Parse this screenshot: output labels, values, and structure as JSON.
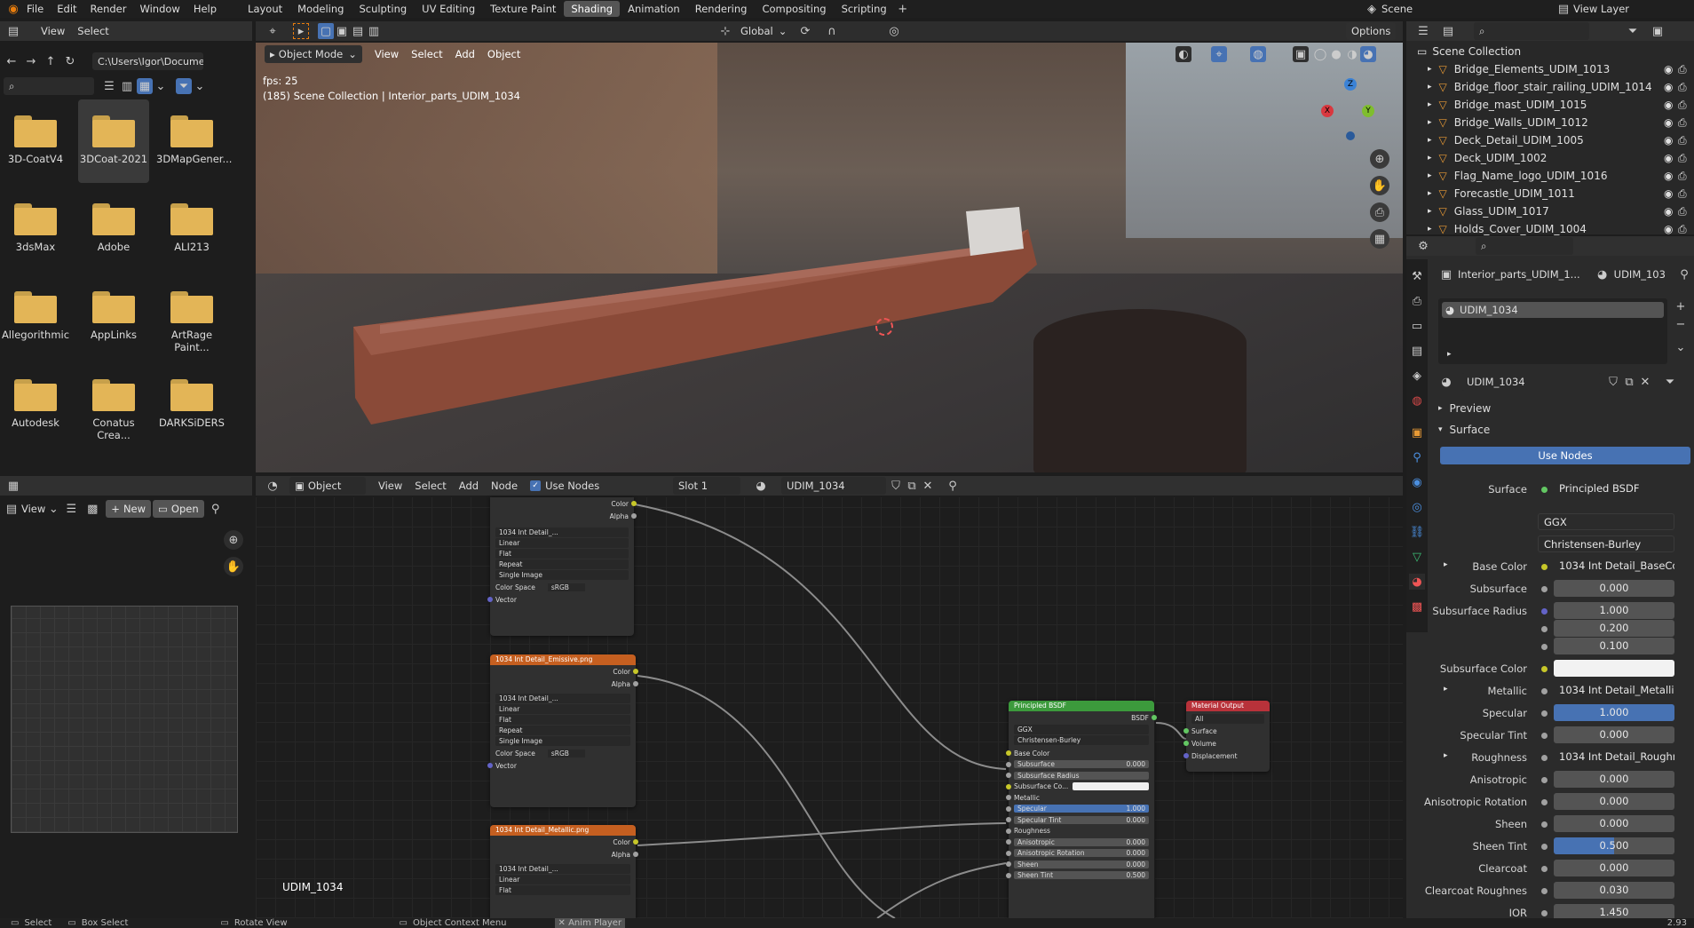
{
  "topbar": {
    "menus": [
      "File",
      "Edit",
      "Render",
      "Window",
      "Help"
    ],
    "workspaces": [
      "Layout",
      "Modeling",
      "Sculpting",
      "UV Editing",
      "Texture Paint",
      "Shading",
      "Animation",
      "Rendering",
      "Compositing",
      "Scripting"
    ],
    "active_workspace": "Shading",
    "scene": "Scene",
    "view_layer": "View Layer"
  },
  "filebrowser": {
    "menus": [
      "View",
      "Select"
    ],
    "path": "C:\\Users\\Igor\\Docume...",
    "search_placeholder": "",
    "folders": [
      "3D-CoatV4",
      "3DCoat-2021",
      "3DMapGener...",
      "3dsMax",
      "Adobe",
      "ALI213",
      "Allegorithmic",
      "AppLinks",
      "ArtRage Paint...",
      "Autodesk",
      "Conatus Crea...",
      "DARKSiDERS"
    ]
  },
  "viewport": {
    "mode": "Object Mode",
    "menus": [
      "View",
      "Select",
      "Add",
      "Object"
    ],
    "orientation": "Global",
    "options": "Options",
    "fps": "fps: 25",
    "info": "(185) Scene Collection | Interior_parts_UDIM_1034",
    "axes": {
      "x": "X",
      "y": "Y",
      "z": "Z"
    }
  },
  "imageeditor": {
    "view": "View",
    "new": "New",
    "open": "Open"
  },
  "nodeeditor": {
    "type": "Object",
    "menus": [
      "View",
      "Select",
      "Add",
      "Node"
    ],
    "use_nodes": "Use Nodes",
    "slot": "Slot 1",
    "material": "UDIM_1034",
    "label": "UDIM_1034",
    "tex1": {
      "image": "1034 Int Detail_...",
      "interp": "Linear",
      "proj": "Flat",
      "ext": "Repeat",
      "src": "Single Image",
      "cs_label": "Color Space",
      "cs": "sRGB",
      "vector": "Vector",
      "color": "Color",
      "alpha": "Alpha"
    },
    "tex2": {
      "title": "1034 Int Detail_Emissive.png",
      "image": "1034 Int Detail_..."
    },
    "tex3": {
      "title": "1034 Int Detail_Metallic.png",
      "image": "1034 Int Detail_..."
    },
    "bsdf": {
      "title": "Principled BSDF",
      "out": "BSDF",
      "dist": "GGX",
      "sss": "Christensen-Burley",
      "rows": [
        [
          "Base Color",
          ""
        ],
        [
          "Subsurface",
          "0.000"
        ],
        [
          "Subsurface Radius",
          ""
        ],
        [
          "Subsurface Co...",
          ""
        ],
        [
          "Metallic",
          ""
        ],
        [
          "Specular",
          "1.000"
        ],
        [
          "Specular Tint",
          "0.000"
        ],
        [
          "Roughness",
          ""
        ],
        [
          "Anisotropic",
          "0.000"
        ],
        [
          "Anisotropic Rotation",
          "0.000"
        ],
        [
          "Sheen",
          "0.000"
        ],
        [
          "Sheen Tint",
          "0.500"
        ]
      ]
    },
    "output": {
      "title": "Material Output",
      "target": "All",
      "rows": [
        "Surface",
        "Volume",
        "Displacement"
      ]
    }
  },
  "outliner": {
    "root": "Scene Collection",
    "items": [
      "Bridge_Elements_UDIM_1013",
      "Bridge_floor_stair_railing_UDIM_1014",
      "Bridge_mast_UDIM_1015",
      "Bridge_Walls_UDIM_1012",
      "Deck_Detail_UDIM_1005",
      "Deck_UDIM_1002",
      "Flag_Name_logo_UDIM_1016",
      "Forecastle_UDIM_1011",
      "Glass_UDIM_1017",
      "Holds_Cover_UDIM_1004"
    ]
  },
  "properties": {
    "object": "Interior_parts_UDIM_1...",
    "material_short": "UDIM_103",
    "slot": "UDIM_1034",
    "material": "UDIM_1034",
    "preview": "Preview",
    "surface_panel": "Surface",
    "use_nodes": "Use Nodes",
    "rows": [
      {
        "label": "Surface",
        "value": "Principled BSDF",
        "kind": "link"
      },
      {
        "label": "",
        "value": "GGX",
        "kind": "dd"
      },
      {
        "label": "",
        "value": "Christensen-Burley",
        "kind": "dd"
      },
      {
        "label": "Base Color",
        "value": "1034 Int Detail_BaseCol...",
        "kind": "link"
      },
      {
        "label": "Subsurface",
        "value": "0.000",
        "kind": "num"
      },
      {
        "label": "Subsurface Radius",
        "value": "1.000",
        "kind": "num"
      },
      {
        "label": "",
        "value": "0.200",
        "kind": "num"
      },
      {
        "label": "",
        "value": "0.100",
        "kind": "num"
      },
      {
        "label": "Subsurface Color",
        "value": "",
        "kind": "color"
      },
      {
        "label": "Metallic",
        "value": "1034 Int Detail_Metallic...",
        "kind": "link"
      },
      {
        "label": "Specular",
        "value": "1.000",
        "kind": "blue"
      },
      {
        "label": "Specular Tint",
        "value": "0.000",
        "kind": "num"
      },
      {
        "label": "Roughness",
        "value": "1034 Int Detail_Roughne...",
        "kind": "link"
      },
      {
        "label": "Anisotropic",
        "value": "0.000",
        "kind": "num"
      },
      {
        "label": "Anisotropic Rotation",
        "value": "0.000",
        "kind": "num"
      },
      {
        "label": "Sheen",
        "value": "0.000",
        "kind": "num"
      },
      {
        "label": "Sheen Tint",
        "value": "0.500",
        "kind": "half"
      },
      {
        "label": "Clearcoat",
        "value": "0.000",
        "kind": "num"
      },
      {
        "label": "Clearcoat Roughnes",
        "value": "0.030",
        "kind": "num"
      },
      {
        "label": "IOR",
        "value": "1.450",
        "kind": "num"
      }
    ]
  },
  "statusbar": {
    "select": "Select",
    "box": "Box Select",
    "rotate": "Rotate View",
    "context": "Object Context Menu",
    "anim": "Anim Player",
    "version": "2.93"
  }
}
